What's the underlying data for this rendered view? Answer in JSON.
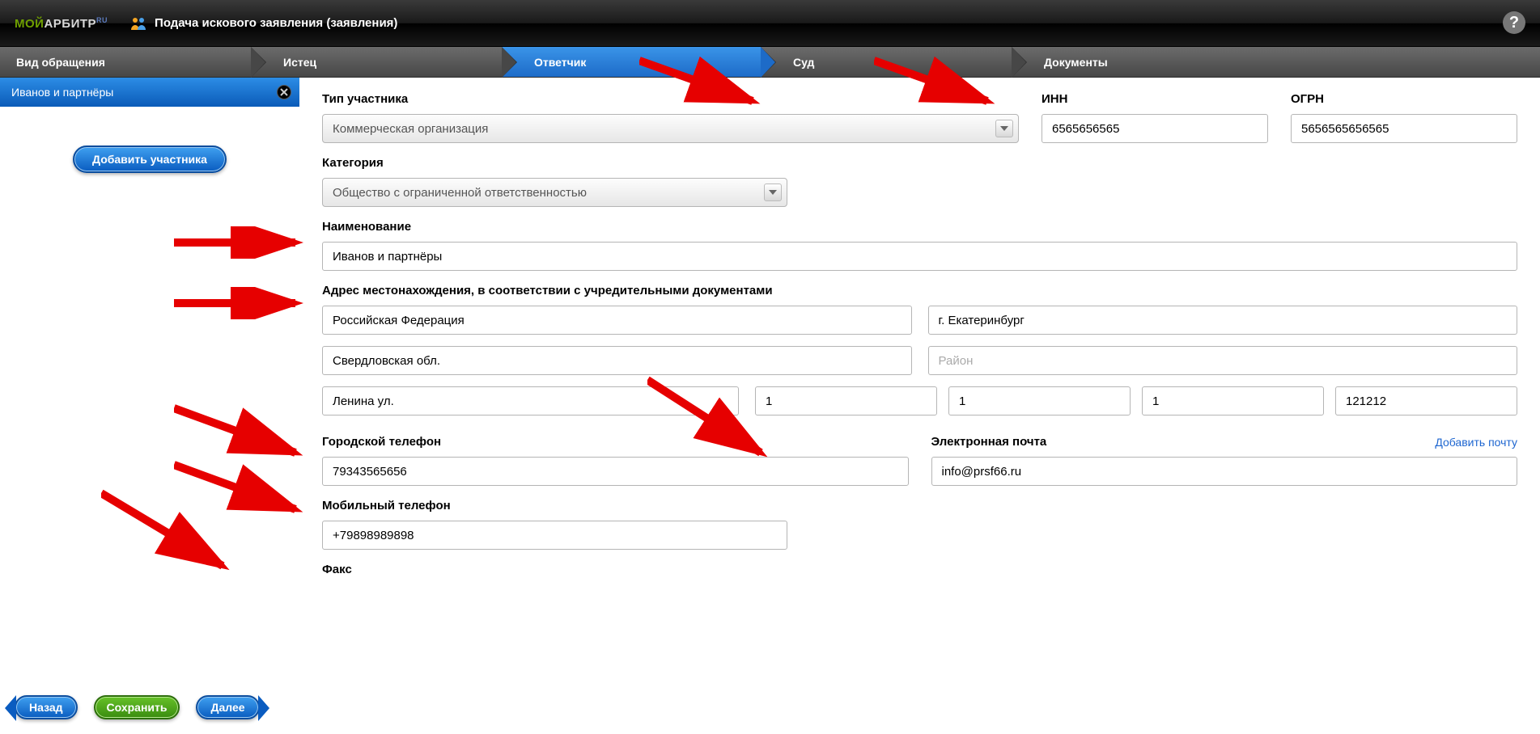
{
  "header": {
    "logo_left": "МОЙ",
    "logo_right": "АРБИТР",
    "logo_sup": "RU",
    "title": "Подача искового заявления (заявления)"
  },
  "steps": {
    "s1": "Вид обращения",
    "s2": "Истец",
    "s3": "Ответчик",
    "s4": "Суд",
    "s5": "Документы"
  },
  "sidebar": {
    "participant": "Иванов и партнёры",
    "add_label": "Добавить участника",
    "back": "Назад",
    "save": "Сохранить",
    "next": "Далее"
  },
  "form": {
    "labels": {
      "type": "Тип участника",
      "inn": "ИНН",
      "ogrn": "ОГРН",
      "category": "Категория",
      "name": "Наименование",
      "address": "Адрес местонахождения, в соответствии с учредительными документами",
      "city_phone": "Городской телефон",
      "mobile_phone": "Мобильный телефон",
      "fax": "Факс",
      "email": "Электронная почта",
      "add_email": "Добавить почту"
    },
    "values": {
      "type": "Коммерческая организация",
      "inn": "6565656565",
      "ogrn": "5656565656565",
      "category": "Общество с ограниченной ответственностью",
      "name": "Иванов и партнёры",
      "country": "Российская Федерация",
      "city": "г. Екатеринбург",
      "region": "Свердловская обл.",
      "district_ph": "Район",
      "street": "Ленина ул.",
      "house_a": "1",
      "house_b": "1",
      "house_c": "1",
      "postal": "121212",
      "city_phone": "79343565656",
      "mobile_phone": "+79898989898",
      "email": "info@prsf66.ru"
    }
  }
}
